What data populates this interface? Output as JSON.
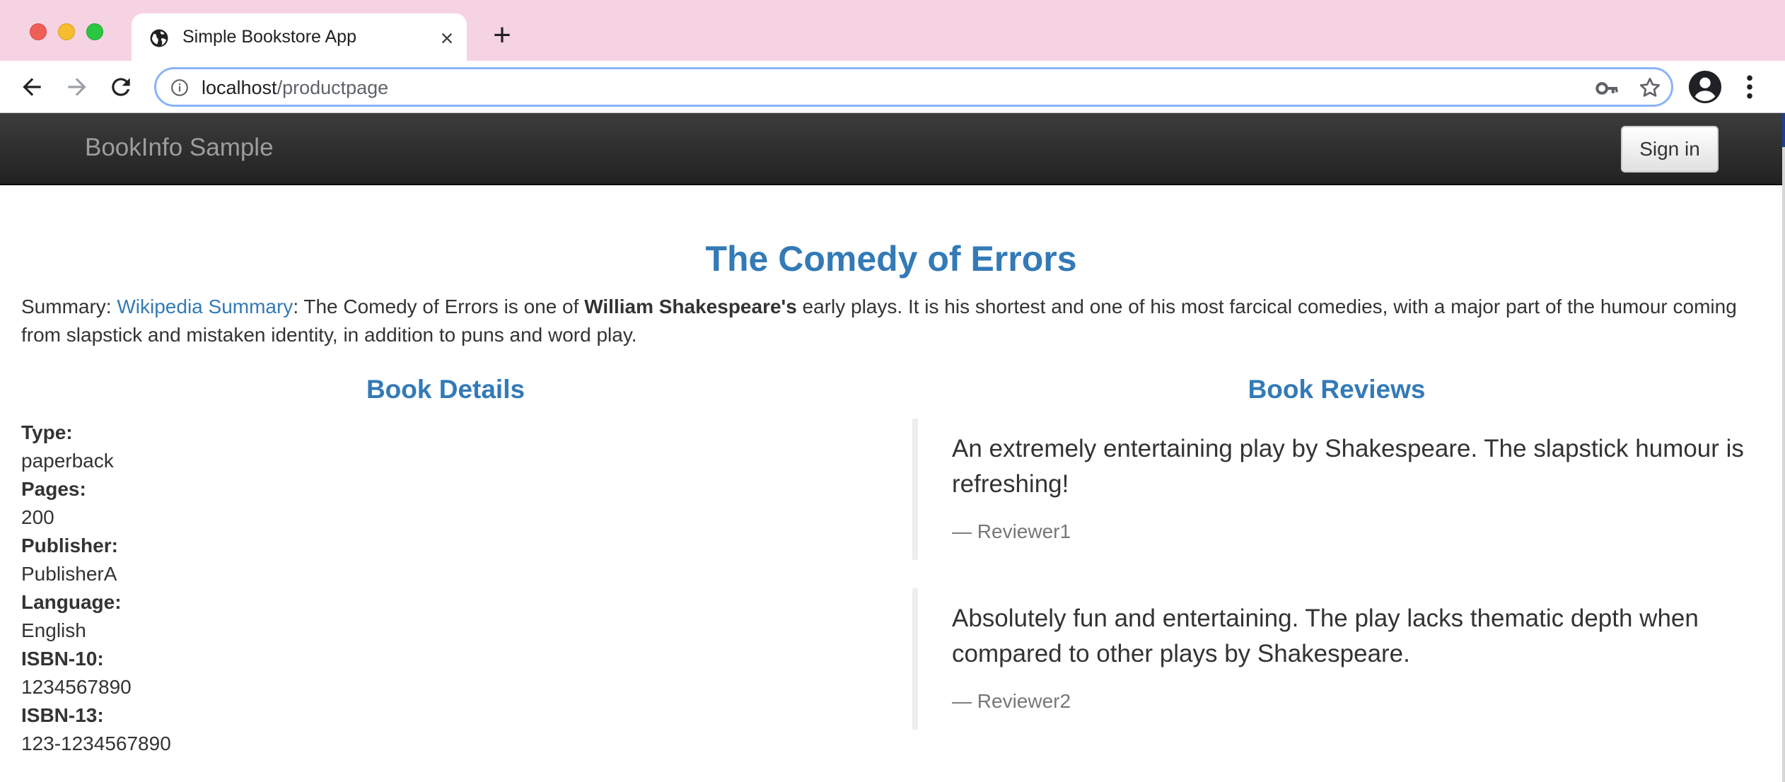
{
  "browser": {
    "tab_title": "Simple Bookstore App",
    "url_host": "localhost",
    "url_path": "/productpage",
    "icons": [
      "globe-icon",
      "close-icon",
      "plus-icon",
      "back-arrow-icon",
      "forward-arrow-icon",
      "reload-icon",
      "info-icon",
      "key-icon",
      "star-icon",
      "account-icon",
      "more-vert-icon"
    ]
  },
  "navbar": {
    "brand": "BookInfo Sample",
    "signin_label": "Sign in"
  },
  "book": {
    "title": "The Comedy of Errors",
    "summary_label": "Summary: ",
    "summary_link": "Wikipedia Summary",
    "summary_pre": ": The Comedy of Errors is one of ",
    "summary_bold": "William Shakespeare's",
    "summary_post": " early plays. It is his shortest and one of his most farcical comedies, with a major part of the humour coming from slapstick and mistaken identity, in addition to puns and word play."
  },
  "details": {
    "heading": "Book Details",
    "items": [
      {
        "label": "Type:",
        "value": "paperback"
      },
      {
        "label": "Pages:",
        "value": "200"
      },
      {
        "label": "Publisher:",
        "value": "PublisherA"
      },
      {
        "label": "Language:",
        "value": "English"
      },
      {
        "label": "ISBN-10:",
        "value": "1234567890"
      },
      {
        "label": "ISBN-13:",
        "value": "123-1234567890"
      }
    ]
  },
  "reviews": {
    "heading": "Book Reviews",
    "items": [
      {
        "text": "An extremely entertaining play by Shakespeare. The slapstick humour is refreshing!",
        "author": "— Reviewer1"
      },
      {
        "text": "Absolutely fun and entertaining. The play lacks thematic depth when compared to other plays by Shakespeare.",
        "author": "— Reviewer2"
      }
    ]
  },
  "colors": {
    "tabstrip": "#f6d3e3",
    "accent": "#337ab7",
    "navbar": "#222222"
  }
}
